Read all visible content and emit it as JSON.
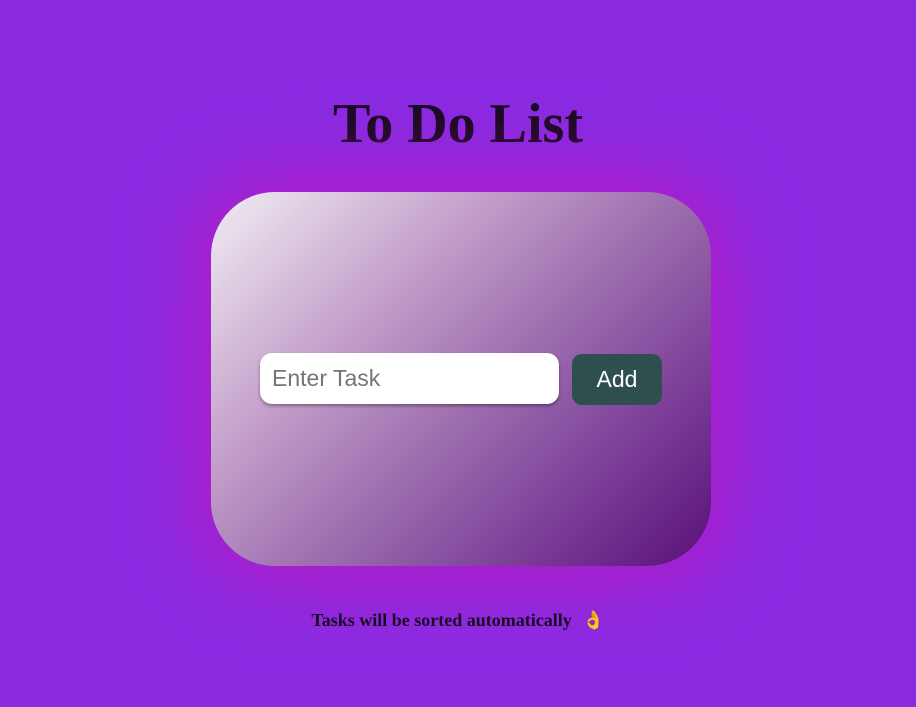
{
  "header": {
    "title": "To Do List"
  },
  "form": {
    "input_value": "",
    "input_placeholder": "Enter Task",
    "add_label": "Add"
  },
  "footer": {
    "note": "Tasks will be sorted automatically",
    "emoji": "👌"
  },
  "colors": {
    "background": "#8a2be2",
    "button": "#2f4f4f",
    "glow": "#c814b4"
  }
}
